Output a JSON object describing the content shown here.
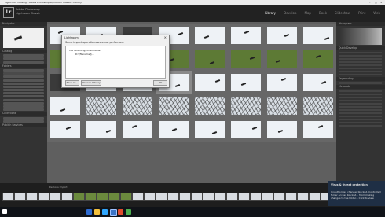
{
  "window": {
    "title": "Lightroom Catalog - Adobe Photoshop Lightroom Classic - Library"
  },
  "identity": {
    "logo": "Lr",
    "brand_line1": "Adobe Photoshop",
    "brand_line2": "Lightroom Classic"
  },
  "modules": [
    "Library",
    "Develop",
    "Map",
    "Book",
    "Slideshow",
    "Print",
    "Web"
  ],
  "left_panel": {
    "navigator": "Navigator",
    "catalog": "Catalog",
    "folders": "Folders",
    "collections": "Collections",
    "publish": "Publish Services"
  },
  "right_panel": {
    "histogram": "Histogram",
    "quick_develop": "Quick Develop",
    "keywording": "Keywording",
    "metadata": "Metadata"
  },
  "dialog": {
    "title": "Lightroom",
    "message": "Some import operations were not performed.",
    "item_header": "File renaming/folder name",
    "item_path": "D:\\[filename]\\...",
    "save_as_label": "Save As...",
    "show_in_library_label": "Show in Library",
    "ok_label": "OK"
  },
  "toast": {
    "title": "Virus & threat protection",
    "body": "Unauthorized changes blocked. Controlled folder access blocked... from making changes to the folder... Click to view."
  },
  "filmstrip": {
    "label": "Previous Import"
  }
}
